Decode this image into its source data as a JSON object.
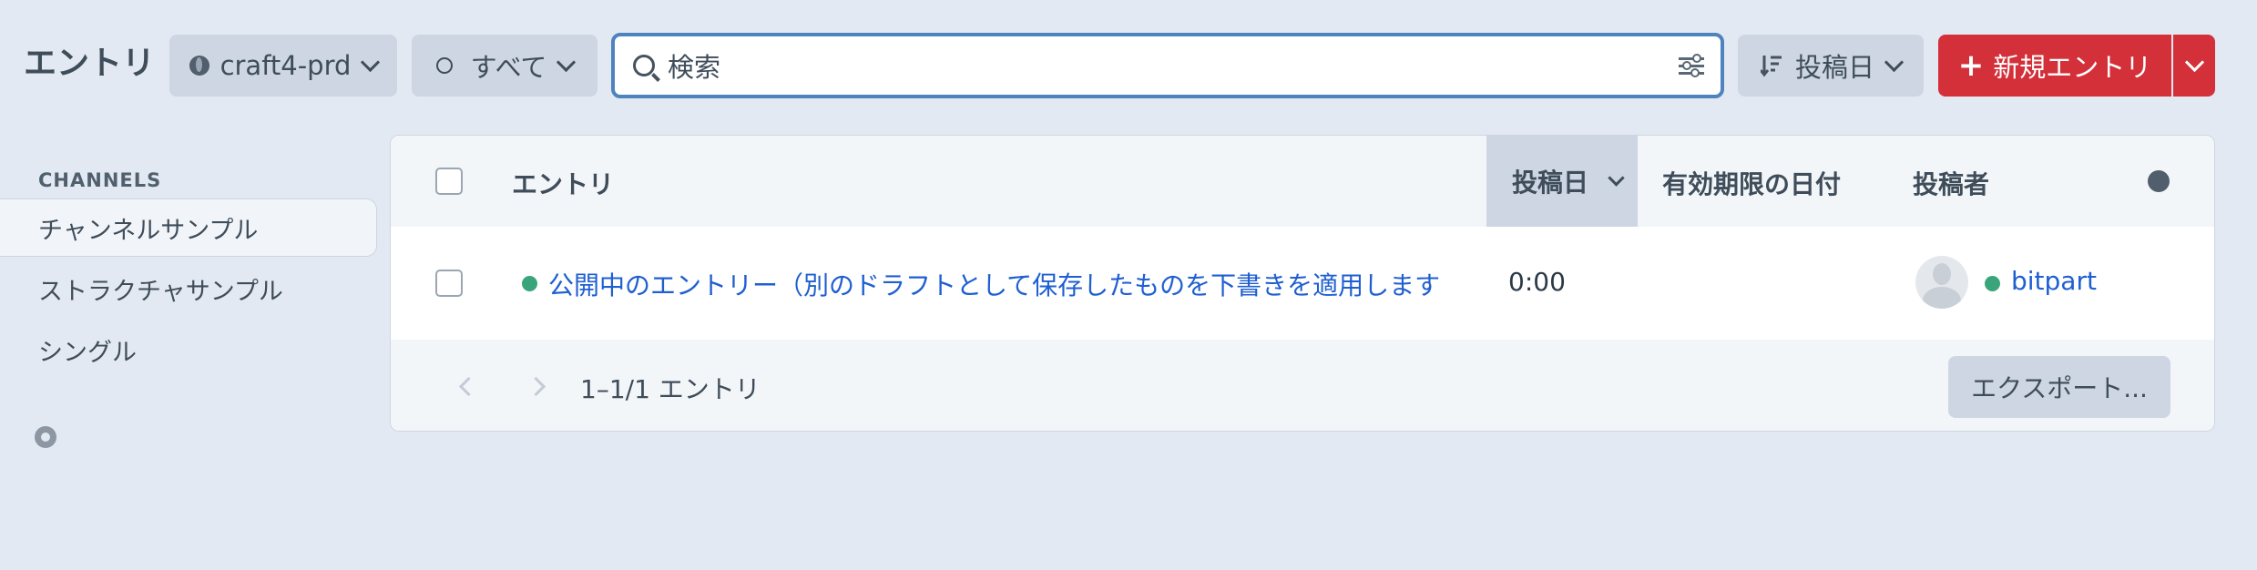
{
  "header": {
    "title": "エントリ",
    "site_label": "craft4-prd",
    "status_label": "すべて",
    "search_placeholder": "検索",
    "sort_label": "投稿日",
    "new_entry_label": "新規エントリ"
  },
  "sidebar": {
    "heading": "CHANNELS",
    "items": [
      {
        "label": "チャンネルサンプル",
        "active": true
      },
      {
        "label": "ストラクチャサンプル",
        "active": false
      },
      {
        "label": "シングル",
        "active": false
      }
    ]
  },
  "table": {
    "columns": [
      "エントリ",
      "投稿日",
      "有効期限の日付",
      "投稿者"
    ],
    "rows": [
      {
        "title": "公開中のエントリー（別のドラフトとして保存したものを下書きを適用します",
        "status": "live",
        "post_date": "0:00",
        "expiry_date": "",
        "author": "bitpart"
      }
    ],
    "pagination_text": "1–1/1 エントリ",
    "export_label": "エクスポート..."
  },
  "colors": {
    "accent": "#d3303a",
    "link": "#1f5fd1",
    "status_live": "#3aa57a",
    "focus_ring": "#4f83be"
  }
}
